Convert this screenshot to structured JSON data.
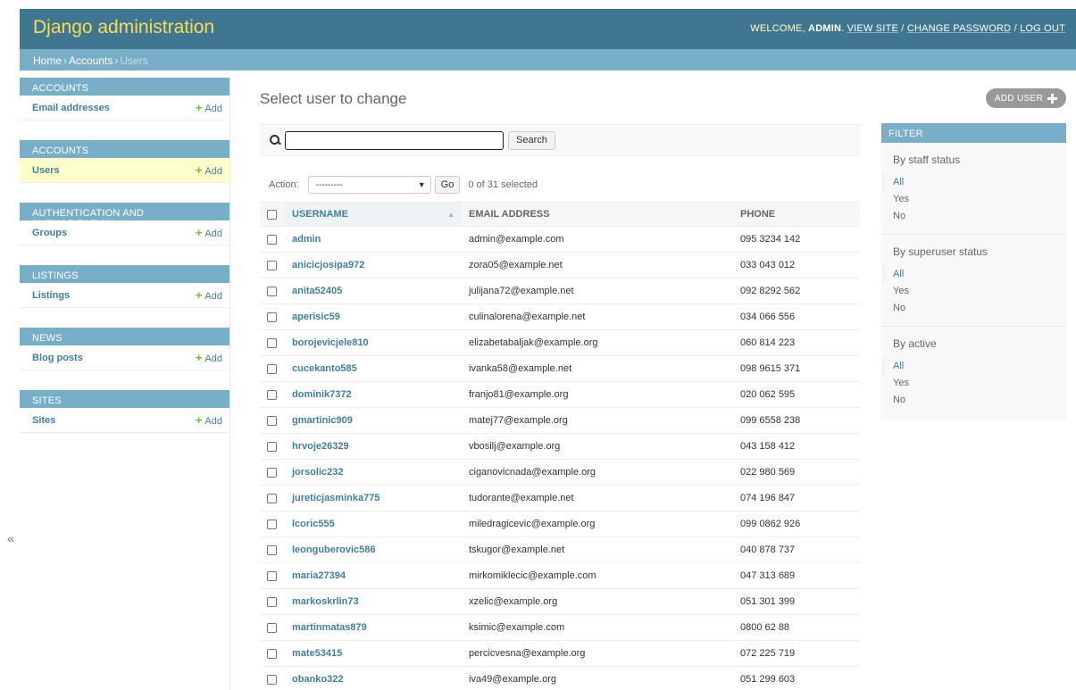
{
  "header": {
    "branding": "Django administration",
    "welcome": "WELCOME,",
    "user": "ADMIN",
    "view_site": "VIEW SITE",
    "change_password": "CHANGE PASSWORD",
    "log_out": "LOG OUT"
  },
  "breadcrumbs": {
    "home": "Home",
    "accounts": "Accounts",
    "current": "Users"
  },
  "nav_toggle": "«",
  "sidebar": {
    "modules": [
      {
        "caption": "Accounts",
        "rows": [
          {
            "label": "Email addresses",
            "add": "Add"
          }
        ]
      },
      {
        "caption": "Accounts",
        "rows": [
          {
            "label": "Users",
            "add": "Add"
          }
        ]
      },
      {
        "caption": "Authentication and Authorization",
        "rows": [
          {
            "label": "Groups",
            "add": "Add"
          }
        ]
      },
      {
        "caption": "Listings",
        "rows": [
          {
            "label": "Listings",
            "add": "Add"
          }
        ]
      },
      {
        "caption": "News",
        "rows": [
          {
            "label": "Blog posts",
            "add": "Add"
          }
        ]
      },
      {
        "caption": "Sites",
        "rows": [
          {
            "label": "Sites",
            "add": "Add"
          }
        ]
      }
    ]
  },
  "content": {
    "title": "Select user to change",
    "add_user": "ADD USER",
    "search": {
      "value": "",
      "button": "Search"
    },
    "actions": {
      "label": "Action:",
      "selected": "---------",
      "go": "Go",
      "count": "0 of 31 selected"
    }
  },
  "table": {
    "columns": [
      "Username",
      "Email address",
      "Phone"
    ],
    "rows": [
      [
        "admin",
        "admin@example.com",
        "095 3234 142"
      ],
      [
        "anicicjosipa972",
        "zora05@example.net",
        "033 043 012"
      ],
      [
        "anita52405",
        "julijana72@example.net",
        "092 8292 562"
      ],
      [
        "aperisic59",
        "culinalorena@example.net",
        "034 066 556"
      ],
      [
        "borojevicjele810",
        "elizabetabaljak@example.org",
        "060 814 223"
      ],
      [
        "cucekanto585",
        "ivanka58@example.net",
        "098 9615 371"
      ],
      [
        "dominik7372",
        "franjo81@example.org",
        "020 062 595"
      ],
      [
        "gmartinic909",
        "matej77@example.org",
        "099 6558 238"
      ],
      [
        "hrvoje26329",
        "vbosilj@example.org",
        "043 158 412"
      ],
      [
        "jorsolic232",
        "ciganovicnada@example.org",
        "022 980 569"
      ],
      [
        "jureticjasminka775",
        "tudorante@example.net",
        "074 196 847"
      ],
      [
        "lcoric555",
        "miledragicevic@example.org",
        "099 0862 926"
      ],
      [
        "leonguberovic586",
        "tskugor@example.net",
        "040 878 737"
      ],
      [
        "maria27394",
        "mirkomiklecic@example.com",
        "047 313 689"
      ],
      [
        "markoskrlin73",
        "xzelic@example.org",
        "051 301 399"
      ],
      [
        "martinmatas879",
        "ksimic@example.com",
        "0800 62 88"
      ],
      [
        "mate53415",
        "percicvesna@example.org",
        "072 225 719"
      ],
      [
        "obanko322",
        "iva49@example.org",
        "051 299 603"
      ]
    ]
  },
  "filter": {
    "caption": "Filter",
    "groups": [
      {
        "title": "By staff status",
        "options": [
          "All",
          "Yes",
          "No"
        ]
      },
      {
        "title": "By superuser status",
        "options": [
          "All",
          "Yes",
          "No"
        ]
      },
      {
        "title": "By active",
        "options": [
          "All",
          "Yes",
          "No"
        ]
      }
    ]
  },
  "colors": {
    "header": "#417690",
    "module": "#79aec8",
    "link": "#447e9b",
    "brand": "#f5dd5d",
    "add_green": "#70bf2b"
  }
}
